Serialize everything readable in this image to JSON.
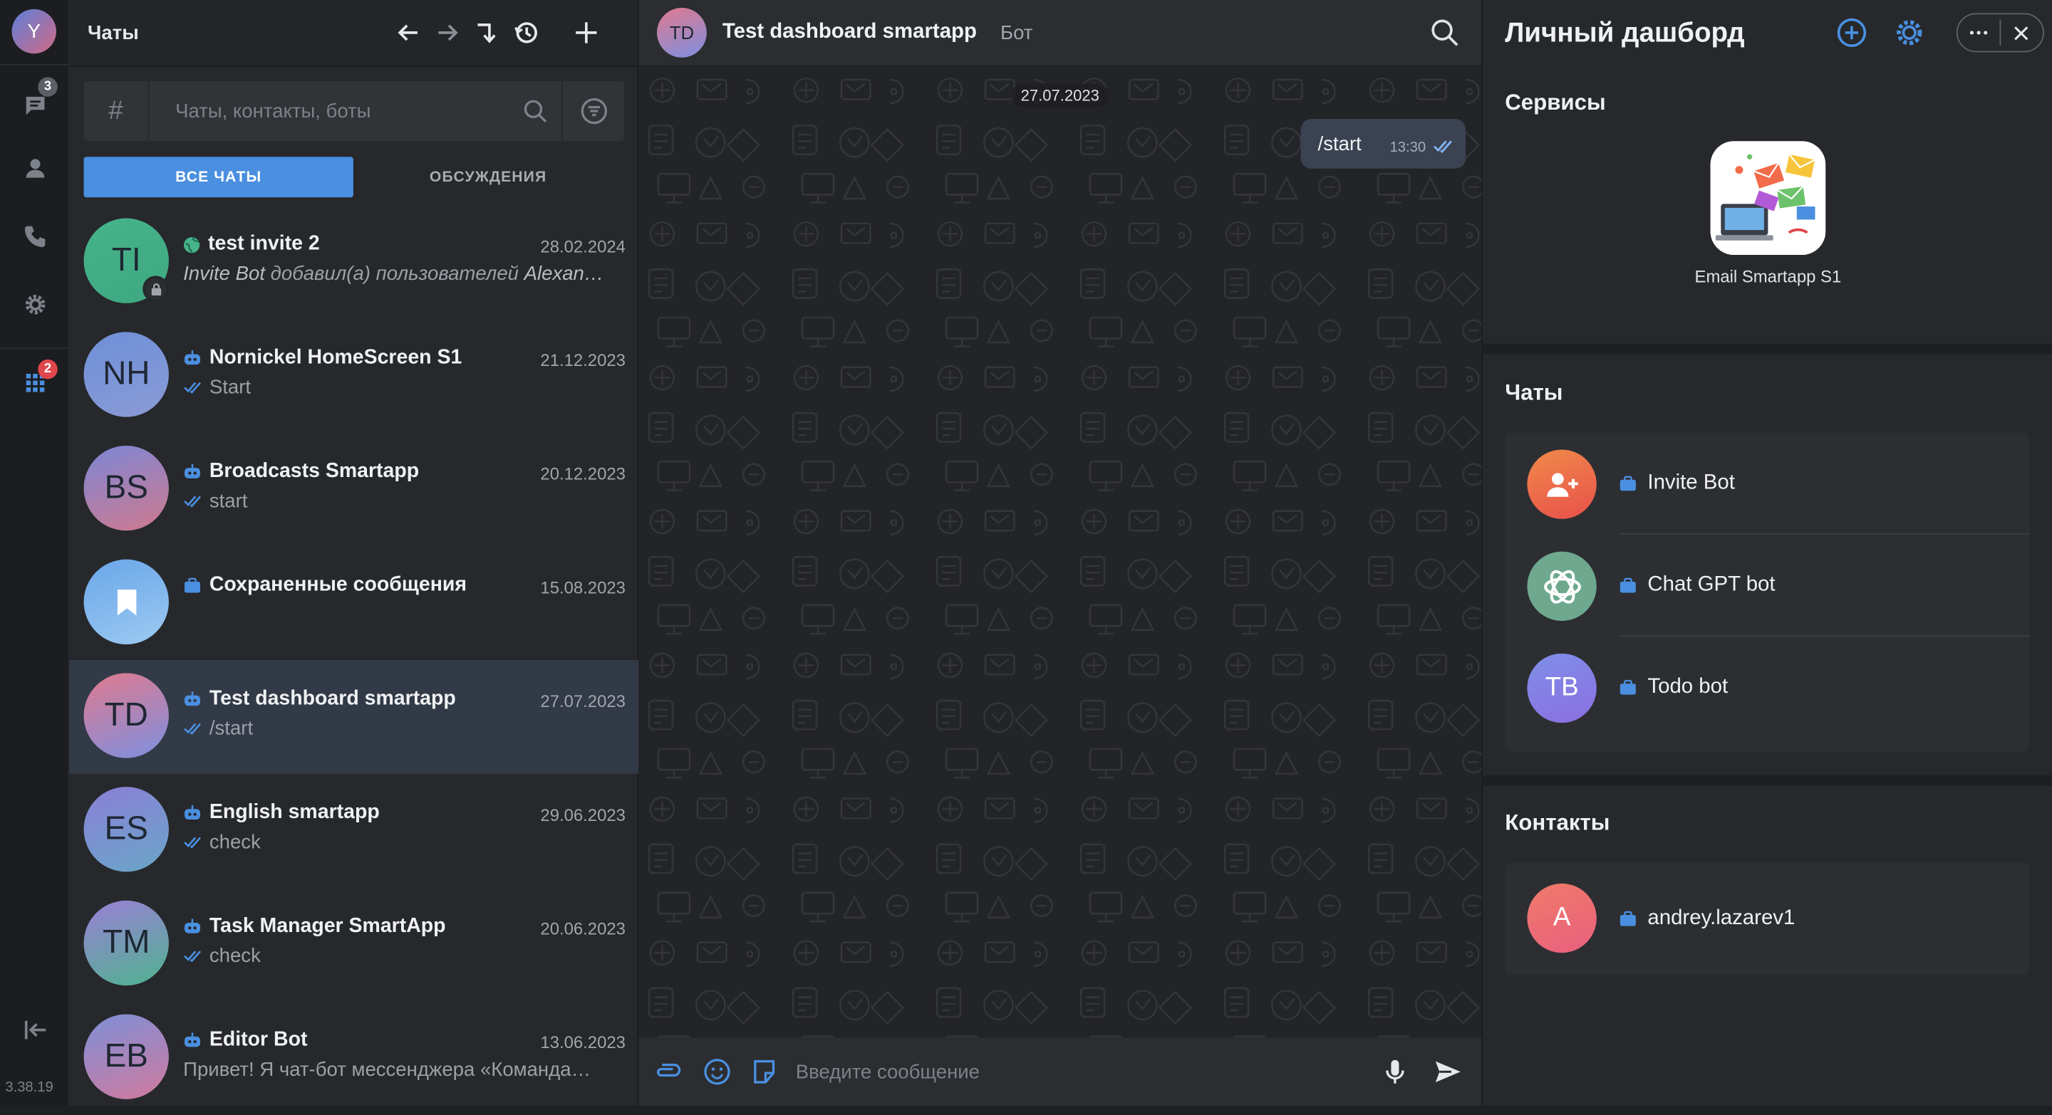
{
  "rail": {
    "me_initial": "Y",
    "chats_badge": "3",
    "apps_badge": "2",
    "version": "3.38.19"
  },
  "chats_panel": {
    "title": "Чаты",
    "search": {
      "hash": "#",
      "placeholder": "Чаты, контакты, боты"
    },
    "tabs": {
      "all": "ВСЕ ЧАТЫ",
      "discussions": "ОБСУЖДЕНИЯ"
    },
    "items": [
      {
        "initials": "TI",
        "name": "test invite 2",
        "date": "28.02.2024",
        "sub_actor": "Invite Bot",
        "sub_text": " добавил(а) пользователей ",
        "sub_tail": "Alexan…",
        "kind": "group"
      },
      {
        "initials": "NH",
        "name": "Nornickel HomeScreen S1",
        "date": "21.12.2023",
        "sub_text": "Start",
        "kind": "bot"
      },
      {
        "initials": "BS",
        "name": "Broadcasts Smartapp",
        "date": "20.12.2023",
        "sub_text": "start",
        "kind": "bot"
      },
      {
        "initials": "",
        "name": "Сохраненные сообщения",
        "date": "15.08.2023",
        "sub_text": "",
        "kind": "saved"
      },
      {
        "initials": "TD",
        "name": "Test dashboard smartapp",
        "date": "27.07.2023",
        "sub_text": "/start",
        "kind": "bot"
      },
      {
        "initials": "ES",
        "name": "English smartapp",
        "date": "29.06.2023",
        "sub_text": "check",
        "kind": "bot"
      },
      {
        "initials": "TM",
        "name": "Task Manager SmartApp",
        "date": "20.06.2023",
        "sub_text": "check",
        "kind": "bot"
      },
      {
        "initials": "EB",
        "name": "Editor Bot",
        "date": "13.06.2023",
        "sub_text": "Привет! Я чат-бот мессенджера «Команда…",
        "kind": "bot"
      }
    ]
  },
  "conversation": {
    "avatar": "TD",
    "name": "Test dashboard smartapp",
    "kind": "Бот",
    "date_chip": "27.07.2023",
    "message": {
      "text": "/start",
      "time": "13:30"
    },
    "composer_placeholder": "Введите сообщение"
  },
  "dashboard": {
    "title": "Личный дашборд",
    "services_title": "Сервисы",
    "service_label": "Email Smartapp S1",
    "chats_title": "Чаты",
    "chats": [
      {
        "name": "Invite Bot",
        "initials": ""
      },
      {
        "name": "Chat GPT bot",
        "initials": ""
      },
      {
        "name": "Todo bot",
        "initials": "TB"
      }
    ],
    "contacts_title": "Контакты",
    "contacts": [
      {
        "name": "andrey.lazarev1",
        "initials": "A"
      }
    ]
  },
  "colors": {
    "accent": "#4a8fe0",
    "badge_gray": "#5b5f66",
    "badge_red": "#e0474c",
    "selected_row": "#323a47"
  }
}
